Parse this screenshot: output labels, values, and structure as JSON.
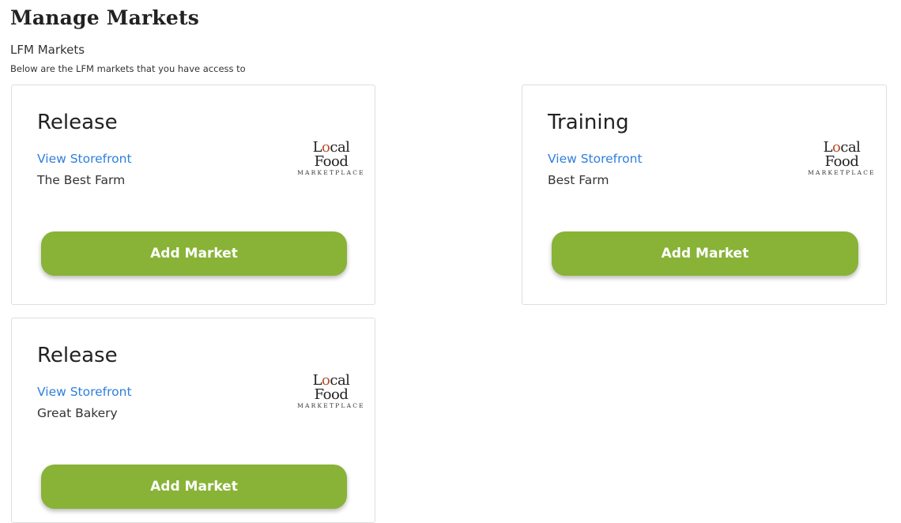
{
  "page": {
    "title": "Manage Markets",
    "section_title": "LFM Markets",
    "section_desc": "Below are the LFM markets that you have access to"
  },
  "logo": {
    "main_pre": "L",
    "main_dot": "o",
    "main_post": "cal Food",
    "sub": "MARKETPLACE"
  },
  "markets": [
    {
      "name": "Release",
      "storefront_link": "View Storefront",
      "farm": "The Best Farm",
      "add_label": "Add Market"
    },
    {
      "name": "Training",
      "storefront_link": "View Storefront",
      "farm": "Best Farm",
      "add_label": "Add Market"
    },
    {
      "name": "Release",
      "storefront_link": "View Storefront",
      "farm": "Great Bakery",
      "add_label": "Add Market"
    }
  ],
  "colors": {
    "button": "#88b337",
    "link": "#2f7fdc",
    "logo_accent": "#b5502a"
  }
}
